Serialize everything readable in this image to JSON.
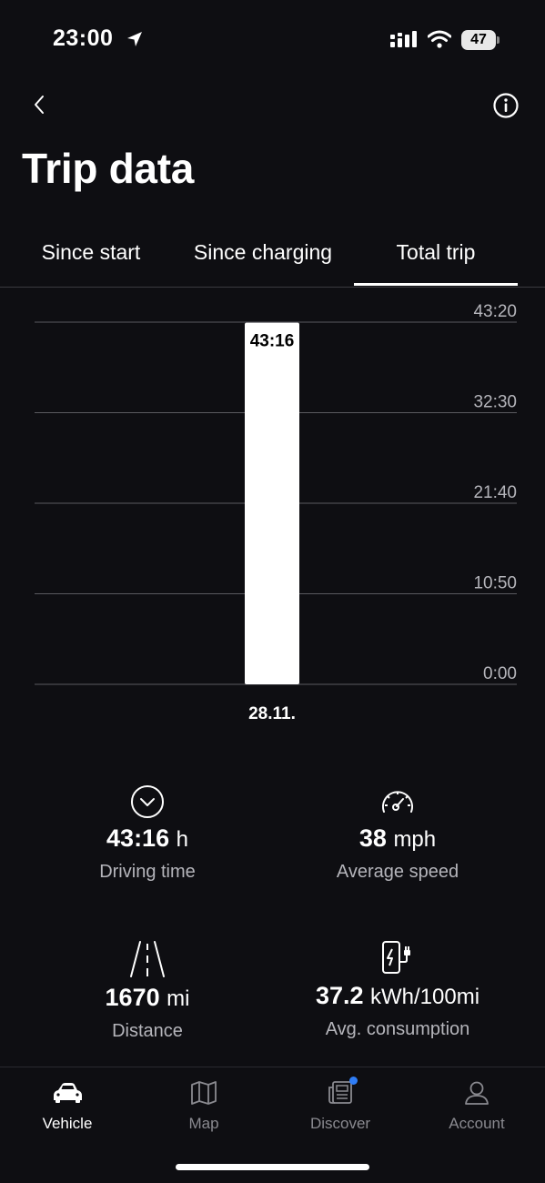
{
  "status_bar": {
    "time": "23:00",
    "battery": "47",
    "icons": [
      "location-arrow-icon",
      "cellular-signal-icon",
      "wifi-icon",
      "battery-icon"
    ]
  },
  "header": {
    "title": "Trip data",
    "back_icon": "chevron-left-icon",
    "info_icon": "info-icon"
  },
  "tabs": [
    {
      "label": "Since start",
      "active": false
    },
    {
      "label": "Since charging",
      "active": false
    },
    {
      "label": "Total trip",
      "active": true
    }
  ],
  "chart_data": {
    "type": "bar",
    "categories": [
      "28.11."
    ],
    "values": [
      "43:16"
    ],
    "data_labels": [
      "43:16"
    ],
    "y_ticks": [
      "0:00",
      "10:50",
      "21:40",
      "32:30",
      "43:20"
    ],
    "ylim": [
      "0:00",
      "43:20"
    ],
    "grid": true,
    "bar_color": "#ffffff"
  },
  "stats": [
    {
      "icon": "clock-icon",
      "value": "43:16",
      "unit": "h",
      "label": "Driving time"
    },
    {
      "icon": "speedometer-icon",
      "value": "38",
      "unit": "mph",
      "label": "Average speed"
    },
    {
      "icon": "road-icon",
      "value": "1670",
      "unit": "mi",
      "label": "Distance"
    },
    {
      "icon": "ev-charger-icon",
      "value": "37.2",
      "unit": "kWh/100mi",
      "label": "Avg. consumption"
    }
  ],
  "bottom_nav": [
    {
      "label": "Vehicle",
      "icon": "car-icon",
      "active": true
    },
    {
      "label": "Map",
      "icon": "map-icon",
      "active": false
    },
    {
      "label": "Discover",
      "icon": "news-icon",
      "active": false,
      "notification": true
    },
    {
      "label": "Account",
      "icon": "person-icon",
      "active": false
    }
  ],
  "colors": {
    "background": "#0e0e12",
    "text": "#ffffff",
    "muted": "#b5b5bb",
    "notification": "#2f7df6"
  }
}
